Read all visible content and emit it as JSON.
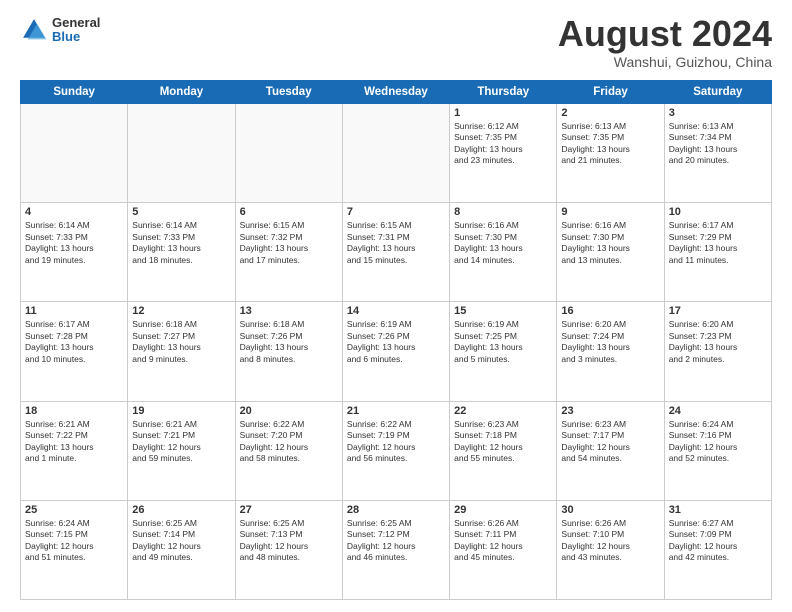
{
  "logo": {
    "general": "General",
    "blue": "Blue"
  },
  "title": "August 2024",
  "location": "Wanshui, Guizhou, China",
  "days_of_week": [
    "Sunday",
    "Monday",
    "Tuesday",
    "Wednesday",
    "Thursday",
    "Friday",
    "Saturday"
  ],
  "weeks": [
    [
      {
        "num": "",
        "info": ""
      },
      {
        "num": "",
        "info": ""
      },
      {
        "num": "",
        "info": ""
      },
      {
        "num": "",
        "info": ""
      },
      {
        "num": "1",
        "info": "Sunrise: 6:12 AM\nSunset: 7:35 PM\nDaylight: 13 hours\nand 23 minutes."
      },
      {
        "num": "2",
        "info": "Sunrise: 6:13 AM\nSunset: 7:35 PM\nDaylight: 13 hours\nand 21 minutes."
      },
      {
        "num": "3",
        "info": "Sunrise: 6:13 AM\nSunset: 7:34 PM\nDaylight: 13 hours\nand 20 minutes."
      }
    ],
    [
      {
        "num": "4",
        "info": "Sunrise: 6:14 AM\nSunset: 7:33 PM\nDaylight: 13 hours\nand 19 minutes."
      },
      {
        "num": "5",
        "info": "Sunrise: 6:14 AM\nSunset: 7:33 PM\nDaylight: 13 hours\nand 18 minutes."
      },
      {
        "num": "6",
        "info": "Sunrise: 6:15 AM\nSunset: 7:32 PM\nDaylight: 13 hours\nand 17 minutes."
      },
      {
        "num": "7",
        "info": "Sunrise: 6:15 AM\nSunset: 7:31 PM\nDaylight: 13 hours\nand 15 minutes."
      },
      {
        "num": "8",
        "info": "Sunrise: 6:16 AM\nSunset: 7:30 PM\nDaylight: 13 hours\nand 14 minutes."
      },
      {
        "num": "9",
        "info": "Sunrise: 6:16 AM\nSunset: 7:30 PM\nDaylight: 13 hours\nand 13 minutes."
      },
      {
        "num": "10",
        "info": "Sunrise: 6:17 AM\nSunset: 7:29 PM\nDaylight: 13 hours\nand 11 minutes."
      }
    ],
    [
      {
        "num": "11",
        "info": "Sunrise: 6:17 AM\nSunset: 7:28 PM\nDaylight: 13 hours\nand 10 minutes."
      },
      {
        "num": "12",
        "info": "Sunrise: 6:18 AM\nSunset: 7:27 PM\nDaylight: 13 hours\nand 9 minutes."
      },
      {
        "num": "13",
        "info": "Sunrise: 6:18 AM\nSunset: 7:26 PM\nDaylight: 13 hours\nand 8 minutes."
      },
      {
        "num": "14",
        "info": "Sunrise: 6:19 AM\nSunset: 7:26 PM\nDaylight: 13 hours\nand 6 minutes."
      },
      {
        "num": "15",
        "info": "Sunrise: 6:19 AM\nSunset: 7:25 PM\nDaylight: 13 hours\nand 5 minutes."
      },
      {
        "num": "16",
        "info": "Sunrise: 6:20 AM\nSunset: 7:24 PM\nDaylight: 13 hours\nand 3 minutes."
      },
      {
        "num": "17",
        "info": "Sunrise: 6:20 AM\nSunset: 7:23 PM\nDaylight: 13 hours\nand 2 minutes."
      }
    ],
    [
      {
        "num": "18",
        "info": "Sunrise: 6:21 AM\nSunset: 7:22 PM\nDaylight: 13 hours\nand 1 minute."
      },
      {
        "num": "19",
        "info": "Sunrise: 6:21 AM\nSunset: 7:21 PM\nDaylight: 12 hours\nand 59 minutes."
      },
      {
        "num": "20",
        "info": "Sunrise: 6:22 AM\nSunset: 7:20 PM\nDaylight: 12 hours\nand 58 minutes."
      },
      {
        "num": "21",
        "info": "Sunrise: 6:22 AM\nSunset: 7:19 PM\nDaylight: 12 hours\nand 56 minutes."
      },
      {
        "num": "22",
        "info": "Sunrise: 6:23 AM\nSunset: 7:18 PM\nDaylight: 12 hours\nand 55 minutes."
      },
      {
        "num": "23",
        "info": "Sunrise: 6:23 AM\nSunset: 7:17 PM\nDaylight: 12 hours\nand 54 minutes."
      },
      {
        "num": "24",
        "info": "Sunrise: 6:24 AM\nSunset: 7:16 PM\nDaylight: 12 hours\nand 52 minutes."
      }
    ],
    [
      {
        "num": "25",
        "info": "Sunrise: 6:24 AM\nSunset: 7:15 PM\nDaylight: 12 hours\nand 51 minutes."
      },
      {
        "num": "26",
        "info": "Sunrise: 6:25 AM\nSunset: 7:14 PM\nDaylight: 12 hours\nand 49 minutes."
      },
      {
        "num": "27",
        "info": "Sunrise: 6:25 AM\nSunset: 7:13 PM\nDaylight: 12 hours\nand 48 minutes."
      },
      {
        "num": "28",
        "info": "Sunrise: 6:25 AM\nSunset: 7:12 PM\nDaylight: 12 hours\nand 46 minutes."
      },
      {
        "num": "29",
        "info": "Sunrise: 6:26 AM\nSunset: 7:11 PM\nDaylight: 12 hours\nand 45 minutes."
      },
      {
        "num": "30",
        "info": "Sunrise: 6:26 AM\nSunset: 7:10 PM\nDaylight: 12 hours\nand 43 minutes."
      },
      {
        "num": "31",
        "info": "Sunrise: 6:27 AM\nSunset: 7:09 PM\nDaylight: 12 hours\nand 42 minutes."
      }
    ]
  ]
}
